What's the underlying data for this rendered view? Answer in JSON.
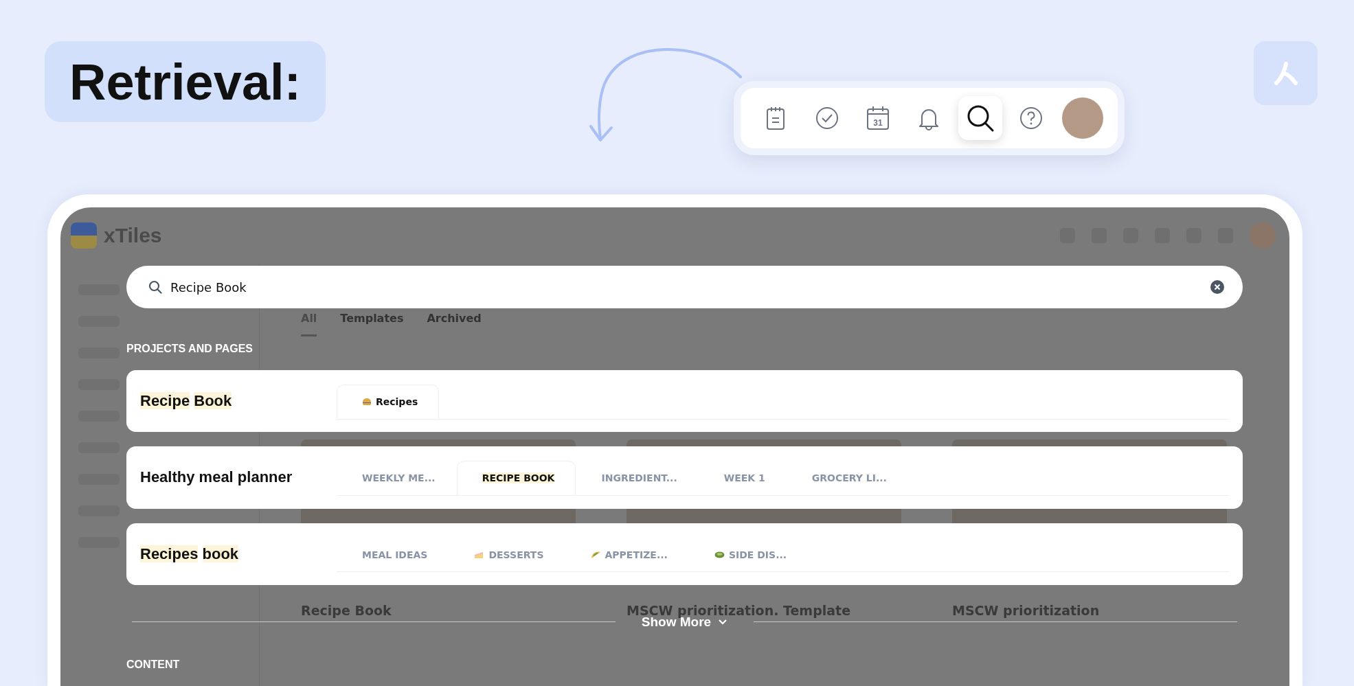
{
  "heading": {
    "title": "Retrieval:"
  },
  "toolbar": [
    {
      "kind": "notes",
      "selected": false
    },
    {
      "kind": "check",
      "selected": false
    },
    {
      "kind": "calendar",
      "selected": false,
      "label": "31"
    },
    {
      "kind": "bell",
      "selected": false
    },
    {
      "kind": "search",
      "selected": true
    },
    {
      "kind": "help",
      "selected": false
    },
    {
      "kind": "avatar",
      "selected": false
    }
  ],
  "app": {
    "brand": "xTiles",
    "view_tabs": [
      {
        "label": "All",
        "selected": true
      },
      {
        "label": "Templates",
        "selected": false
      },
      {
        "label": "Archived",
        "selected": false
      }
    ],
    "cards": [
      "Recipe Book",
      "MSCW prioritization. Template",
      "MSCW prioritization"
    ]
  },
  "search": {
    "value": "Recipe Book"
  },
  "sections": [
    {
      "title": "PROJECTS AND PAGES"
    },
    {
      "title": "CONTENT"
    }
  ],
  "results": [
    {
      "title": [
        {
          "text": "Recipe",
          "highlighted": true
        },
        {
          "text": "Book",
          "highlighted": true
        }
      ],
      "tabs": [
        {
          "label": "Recipes",
          "kind": "bun",
          "selected": true,
          "highlighted": false
        }
      ]
    },
    {
      "title": [
        {
          "text": "Healthy meal planner",
          "highlighted": false
        }
      ],
      "tabs": [
        {
          "label": "WEEKLY ME...",
          "kind": "text",
          "selected": false,
          "highlighted": false
        },
        {
          "label": "RECIPE BOOK",
          "kind": "text",
          "selected": true,
          "highlighted": true
        },
        {
          "label": "INGREDIENT...",
          "kind": "text",
          "selected": false,
          "highlighted": false
        },
        {
          "label": "WEEK 1",
          "kind": "text",
          "selected": false,
          "highlighted": false
        },
        {
          "label": "GROCERY LI...",
          "kind": "text",
          "selected": false,
          "highlighted": false
        }
      ]
    },
    {
      "title": [
        {
          "text": "Recipes",
          "highlighted": true
        },
        {
          "text": "book",
          "highlighted": true
        }
      ],
      "tabs": [
        {
          "label": "MEAL IDEAS",
          "kind": "text",
          "selected": false,
          "highlighted": false
        },
        {
          "label": "DESSERTS",
          "kind": "cake",
          "selected": false,
          "highlighted": false
        },
        {
          "label": "APPETIZE...",
          "kind": "taco",
          "selected": false,
          "highlighted": false
        },
        {
          "label": "SIDE DIS...",
          "kind": "salad",
          "selected": false,
          "highlighted": false
        }
      ]
    }
  ],
  "show_more": {
    "label": "Show More"
  }
}
